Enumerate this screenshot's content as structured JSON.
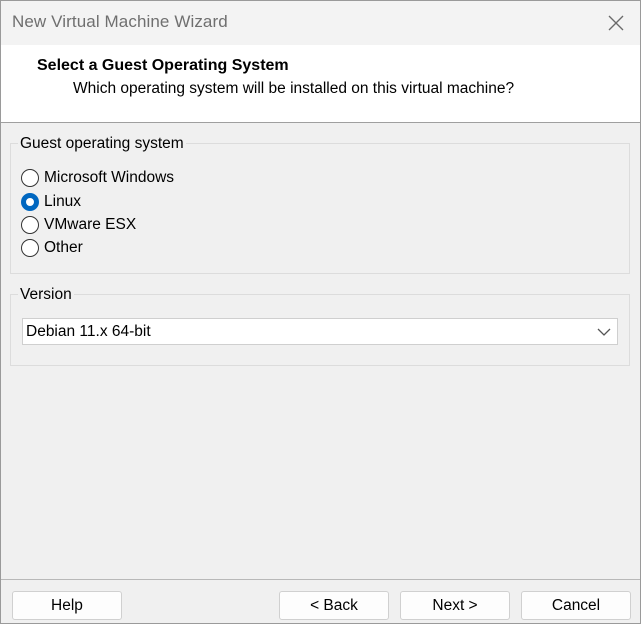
{
  "window": {
    "title": "New Virtual Machine Wizard"
  },
  "header": {
    "title": "Select a Guest Operating System",
    "subtitle": "Which operating system will be installed on this virtual machine?"
  },
  "guest_os": {
    "label": "Guest operating system",
    "options": [
      {
        "label": "Microsoft Windows",
        "selected": false
      },
      {
        "label": "Linux",
        "selected": true
      },
      {
        "label": "VMware ESX",
        "selected": false
      },
      {
        "label": "Other",
        "selected": false
      }
    ]
  },
  "version": {
    "label": "Version",
    "selected_value": "Debian 11.x 64-bit"
  },
  "buttons": {
    "help": "Help",
    "back": "< Back",
    "next": "Next >",
    "cancel": "Cancel"
  },
  "colors": {
    "accent": "#0067c0",
    "dialog_bg": "#f0f0f0",
    "header_bg": "#ffffff",
    "title_text": "#6f6f6f"
  },
  "icons": {
    "close": "close-icon",
    "dropdown": "chevron-down-icon"
  }
}
